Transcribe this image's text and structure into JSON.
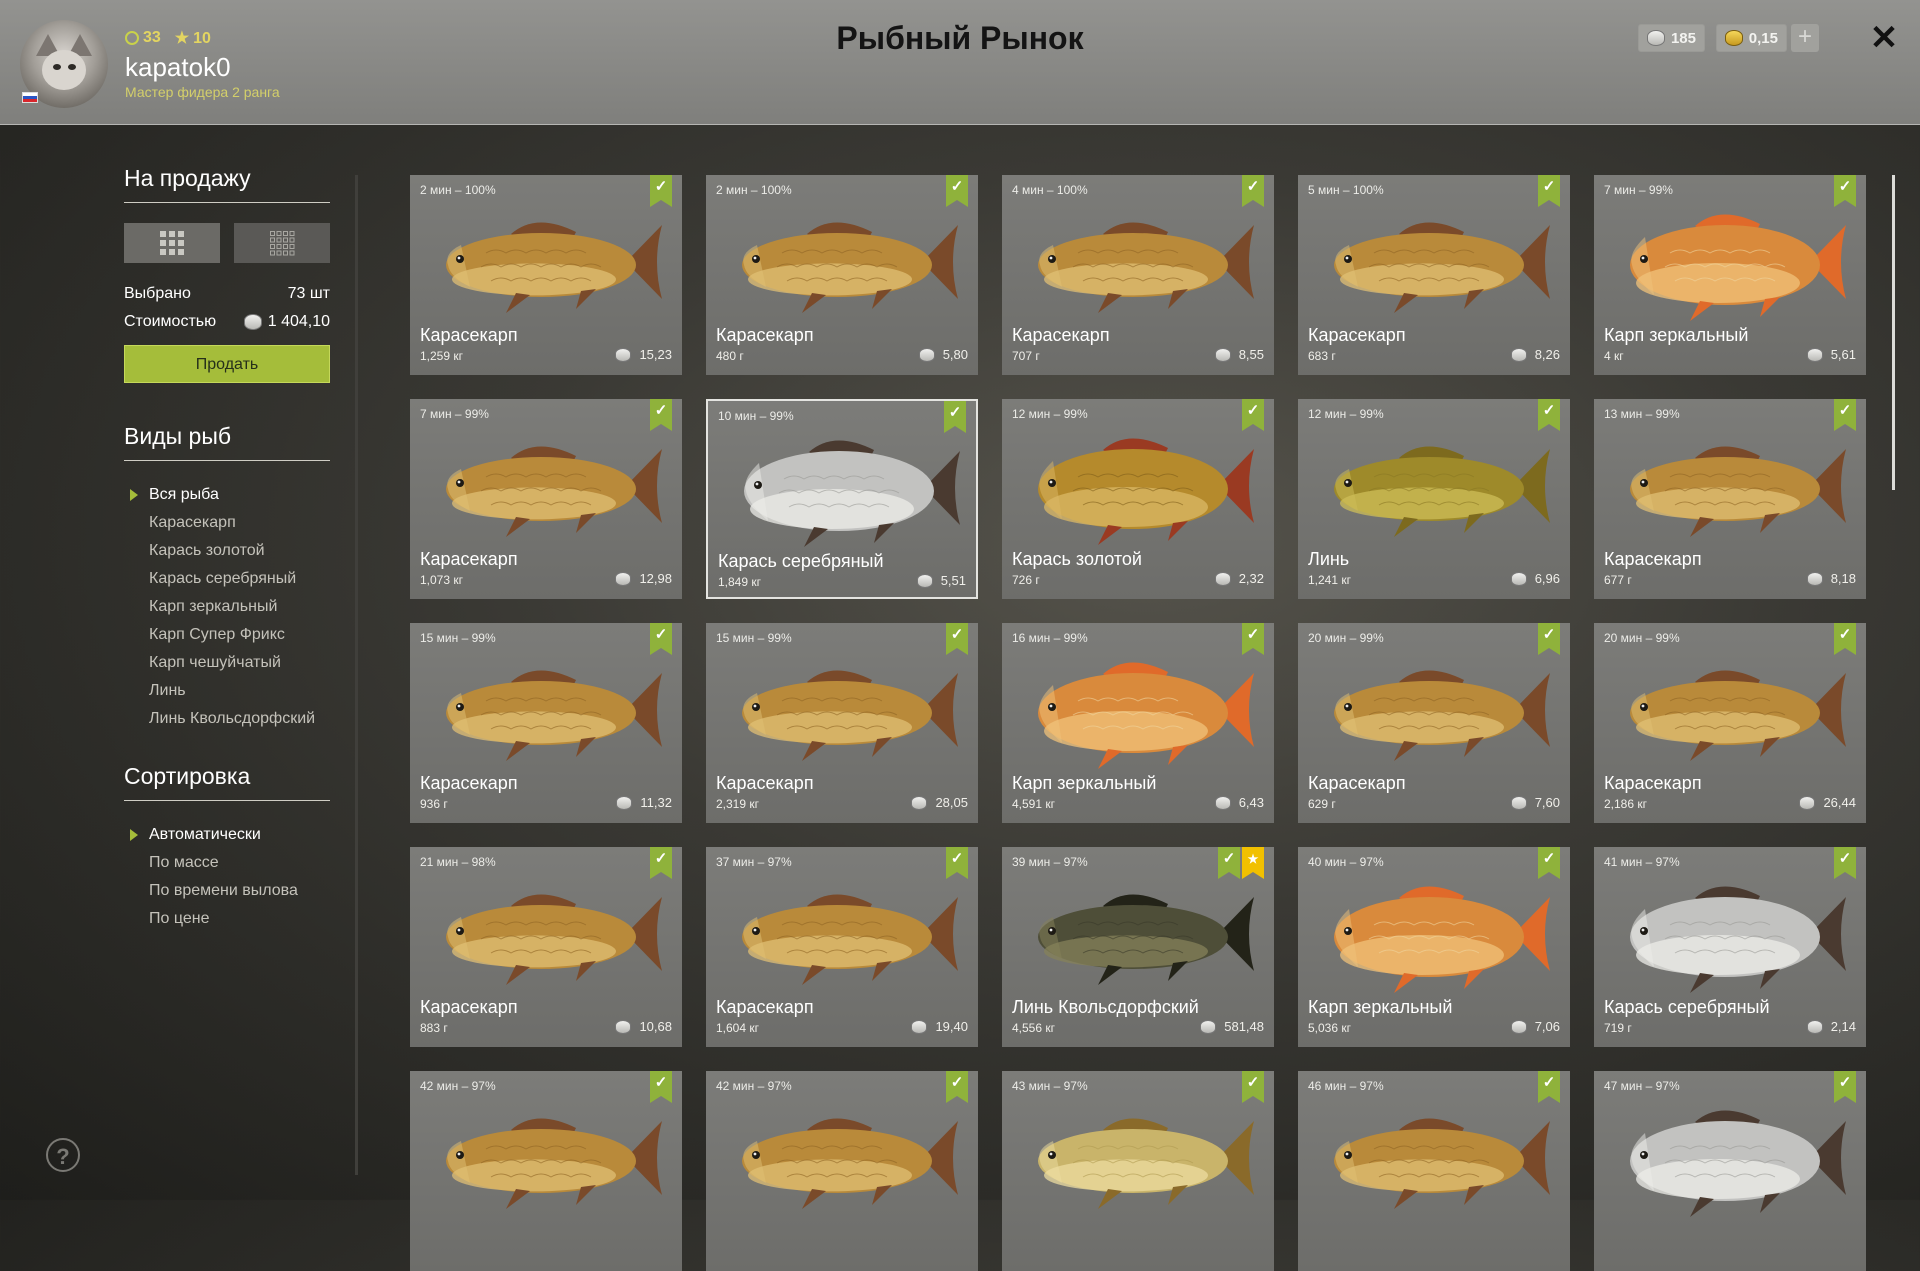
{
  "header": {
    "title": "Рыбный Рынок",
    "user": {
      "level": "33",
      "stars": "10",
      "name": "kapatok0",
      "rank": "Мастер фидера 2 ранга"
    },
    "currency_silver": "185",
    "currency_gold": "0,15",
    "plus_label": "+",
    "close_label": "✕"
  },
  "sidebar": {
    "sale_title": "На продажу",
    "selected_label": "Выбрано",
    "selected_value": "73 шт",
    "cost_label": "Стоимостью",
    "cost_value": "1 404,10",
    "sell_label": "Продать",
    "species_title": "Виды рыб",
    "species": [
      "Вся рыба",
      "Карасекарп",
      "Карась золотой",
      "Карась серебряный",
      "Карп зеркальный",
      "Карп Супер Фрикс",
      "Карп чешуйчатый",
      "Линь",
      "Линь Квольсдорфский"
    ],
    "species_active": 0,
    "sort_title": "Сортировка",
    "sort": [
      "Автоматически",
      "По массе",
      "По времени вылова",
      "По цене"
    ],
    "sort_active": 0
  },
  "colors": {
    "accent": "#a5bd3a",
    "bookmark": "#8fb23b",
    "star": "#f1c000",
    "title": "#141414"
  },
  "cards": [
    {
      "time": "2 мин – 100%",
      "name": "Карасекарп",
      "weight": "1,259 кг",
      "price": "15,23",
      "fish": "carp-hybrid"
    },
    {
      "time": "2 мин – 100%",
      "name": "Карасекарп",
      "weight": "480 г",
      "price": "5,80",
      "fish": "carp-hybrid"
    },
    {
      "time": "4 мин – 100%",
      "name": "Карасекарп",
      "weight": "707 г",
      "price": "8,55",
      "fish": "carp-hybrid"
    },
    {
      "time": "5 мин – 100%",
      "name": "Карасекарп",
      "weight": "683 г",
      "price": "8,26",
      "fish": "carp-hybrid"
    },
    {
      "time": "7 мин – 99%",
      "name": "Карп зеркальный",
      "weight": "4 кг",
      "price": "5,61",
      "fish": "mirror-carp"
    },
    {
      "time": "7 мин – 99%",
      "name": "Карасекарп",
      "weight": "1,073 кг",
      "price": "12,98",
      "fish": "carp-hybrid"
    },
    {
      "time": "10 мин – 99%",
      "name": "Карась серебряный",
      "weight": "1,849 кг",
      "price": "5,51",
      "fish": "silver-crucian",
      "selected": true
    },
    {
      "time": "12 мин – 99%",
      "name": "Карась золотой",
      "weight": "726 г",
      "price": "2,32",
      "fish": "golden-crucian"
    },
    {
      "time": "12 мин – 99%",
      "name": "Линь",
      "weight": "1,241 кг",
      "price": "6,96",
      "fish": "tench"
    },
    {
      "time": "13 мин – 99%",
      "name": "Карасекарп",
      "weight": "677 г",
      "price": "8,18",
      "fish": "carp-hybrid"
    },
    {
      "time": "15 мин – 99%",
      "name": "Карасекарп",
      "weight": "936 г",
      "price": "11,32",
      "fish": "carp-hybrid"
    },
    {
      "time": "15 мин – 99%",
      "name": "Карасекарп",
      "weight": "2,319 кг",
      "price": "28,05",
      "fish": "carp-hybrid"
    },
    {
      "time": "16 мин – 99%",
      "name": "Карп зеркальный",
      "weight": "4,591 кг",
      "price": "6,43",
      "fish": "mirror-carp"
    },
    {
      "time": "20 мин – 99%",
      "name": "Карасекарп",
      "weight": "629 г",
      "price": "7,60",
      "fish": "carp-hybrid"
    },
    {
      "time": "20 мин – 99%",
      "name": "Карасекарп",
      "weight": "2,186 кг",
      "price": "26,44",
      "fish": "carp-hybrid"
    },
    {
      "time": "21 мин – 98%",
      "name": "Карасекарп",
      "weight": "883 г",
      "price": "10,68",
      "fish": "carp-hybrid"
    },
    {
      "time": "37 мин – 97%",
      "name": "Карасекарп",
      "weight": "1,604 кг",
      "price": "19,40",
      "fish": "carp-hybrid"
    },
    {
      "time": "39 мин – 97%",
      "name": "Линь Квольсдорфский",
      "weight": "4,556 кг",
      "price": "581,48",
      "fish": "dark-tench",
      "trophy": true
    },
    {
      "time": "40 мин – 97%",
      "name": "Карп зеркальный",
      "weight": "5,036 кг",
      "price": "7,06",
      "fish": "mirror-carp"
    },
    {
      "time": "41 мин – 97%",
      "name": "Карась серебряный",
      "weight": "719 г",
      "price": "2,14",
      "fish": "silver-crucian"
    },
    {
      "time": "42 мин – 97%",
      "name": "",
      "weight": "",
      "price": "",
      "fish": "carp-hybrid"
    },
    {
      "time": "42 мин – 97%",
      "name": "",
      "weight": "",
      "price": "",
      "fish": "carp-hybrid"
    },
    {
      "time": "43 мин – 97%",
      "name": "",
      "weight": "",
      "price": "",
      "fish": "pale-tench"
    },
    {
      "time": "46 мин – 97%",
      "name": "",
      "weight": "",
      "price": "",
      "fish": "carp-hybrid"
    },
    {
      "time": "47 мин – 97%",
      "name": "",
      "weight": "",
      "price": "",
      "fish": "silver-crucian"
    }
  ]
}
